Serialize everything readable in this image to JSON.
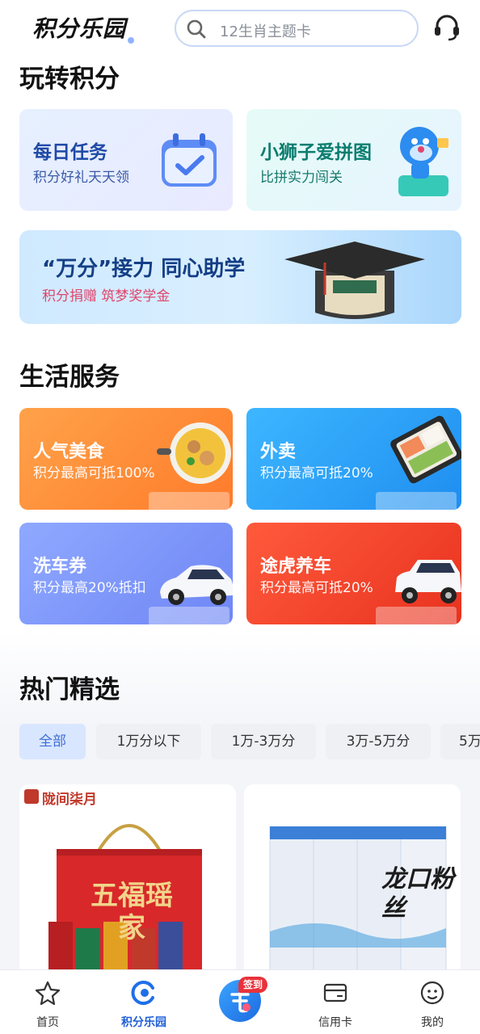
{
  "header": {
    "logo_text": "积分乐园",
    "search_placeholder": "12生肖主题卡"
  },
  "play_section": {
    "title": "玩转积分",
    "cards": [
      {
        "title": "每日任务",
        "subtitle": "积分好礼天天领"
      },
      {
        "title": "小狮子爱拼图",
        "subtitle": "比拼实力闯关"
      }
    ],
    "banner": {
      "title": "“万分”接力 同心助学",
      "subtitle": "积分捐赠 筑梦奖学金"
    }
  },
  "life_section": {
    "title": "生活服务",
    "cards": [
      {
        "title": "人气美食",
        "subtitle": "积分最高可抵100%"
      },
      {
        "title": "外卖",
        "subtitle": "积分最高可抵20%"
      },
      {
        "title": "洗车券",
        "subtitle": "积分最高20%抵扣"
      },
      {
        "title": "途虎养车",
        "subtitle": "积分最高可抵20%"
      }
    ]
  },
  "hot_section": {
    "title": "热门精选",
    "filters": [
      "全部",
      "1万分以下",
      "1万-3万分",
      "3万-5万分",
      "5万"
    ],
    "active_filter": "全部",
    "products": [
      {
        "brand_text": "陇间柒月",
        "package_text": "五福瑶家"
      },
      {
        "package_text": "龙口粉丝"
      }
    ]
  },
  "bottom_nav": {
    "items": [
      {
        "label": "首页",
        "icon": "star-icon"
      },
      {
        "label": "积分乐园",
        "icon": "points-icon",
        "active": true
      },
      {
        "label": "",
        "icon": "checkin-icon",
        "badge": "签到"
      },
      {
        "label": "信用卡",
        "icon": "credit-card-icon"
      },
      {
        "label": "我的",
        "icon": "profile-icon"
      }
    ]
  },
  "colors": {
    "accent": "#1f5fd6",
    "food": "#ff8a30",
    "takeaway": "#2a9cf5",
    "carwash": "#7f97fa",
    "tuhu": "#f0402a"
  }
}
